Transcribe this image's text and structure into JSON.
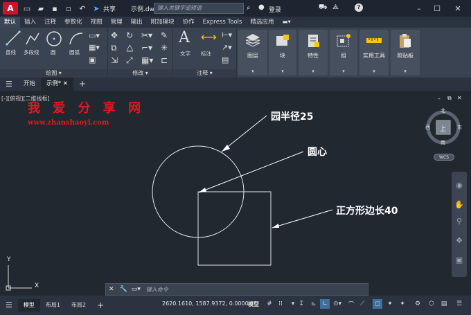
{
  "titlebar": {
    "logo": "A",
    "share_label": "共享",
    "filename": "示例.dwg",
    "search_placeholder": "键入关键字或短语",
    "login_label": "登录",
    "help_label": "?"
  },
  "menu_tabs": [
    "默认",
    "插入",
    "注释",
    "参数化",
    "视图",
    "管理",
    "输出",
    "附加模块",
    "协作",
    "Express Tools",
    "精选应用"
  ],
  "ribbon": {
    "draw": {
      "title": "绘图",
      "tools": [
        "直线",
        "多段线",
        "圆",
        "圆弧"
      ]
    },
    "modify": {
      "title": "修改"
    },
    "annotation": {
      "title": "注释",
      "tools": [
        "文字",
        "标注"
      ]
    },
    "big_panels": [
      "图层",
      "块",
      "特性",
      "组",
      "实用工具",
      "剪贴板"
    ]
  },
  "file_tabs": {
    "start": "开始",
    "current": "示例*"
  },
  "canvas": {
    "view_label": "[-][俯视][二维线框]",
    "watermark_title": "我 爱 分 享 网",
    "watermark_url": "www.zhanshaoyi.com",
    "annotations": {
      "circle_radius": "园半径25",
      "center": "圆心",
      "square_side": "正方形边长40"
    },
    "viewcube": {
      "north": "北",
      "south": "南",
      "east": "东",
      "west": "西",
      "top": "上",
      "wcs": "WCS"
    },
    "ucs": {
      "x": "X",
      "y": "Y"
    }
  },
  "command": {
    "placeholder": "键入命令"
  },
  "status": {
    "tabs": [
      "模型",
      "布局1",
      "布局2"
    ],
    "coords": "2620.1610, 1587.9372, 0.0000",
    "mode": "模型"
  },
  "colors": {
    "accent": "#c5172c",
    "canvas": "#212830",
    "watermark": "#e01b1b"
  }
}
